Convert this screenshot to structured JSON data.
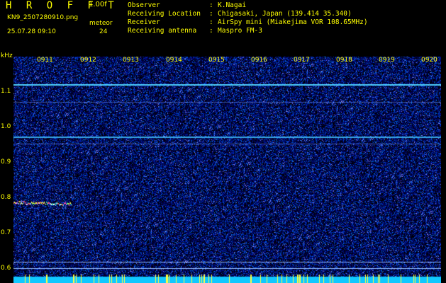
{
  "header": {
    "app_title": "H R O F F T",
    "version": "1.00f",
    "filename": "KN9_2507280910.png",
    "meteor_label": "meteor",
    "datetime": "25.07.28 09:10",
    "meteor_count": "24",
    "info": [
      {
        "label": "Observer",
        "value": "K.Nagai"
      },
      {
        "label": "Receiving Location",
        "value": "Chigasaki, Japan (139.414 35.340)"
      },
      {
        "label": "Receiver",
        "value": "AirSpy mini (Miakejima VOR 108.65MHz)"
      },
      {
        "label": "Receiving antenna",
        "value": "Maspro FM-3"
      }
    ]
  },
  "plot": {
    "unit_label": "kHz",
    "time_ticks": [
      "0911",
      "0912",
      "0913",
      "0914",
      "0915",
      "0916",
      "0917",
      "0918",
      "0919",
      "0920"
    ],
    "freq_ticks": [
      "1.1",
      "1.0",
      "0.9",
      "0.8",
      "0.7",
      "0.6"
    ]
  },
  "colors": {
    "label": "#ffff00",
    "background": "#000000",
    "noise_base": "#00008b",
    "carrier_line": "#40c8ff",
    "bottom_band": "#00c8ff"
  }
}
